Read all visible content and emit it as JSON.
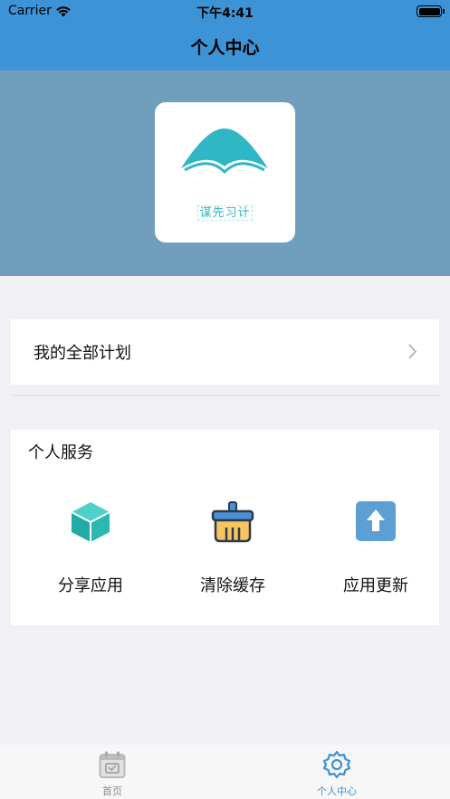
{
  "status_bar": {
    "carrier": "Carrier",
    "time": "下午4:41"
  },
  "nav": {
    "title": "个人中心"
  },
  "logo": {
    "text": "谋先习计",
    "colors": {
      "primary": "#30b7c6"
    }
  },
  "plan": {
    "label": "我的全部计划"
  },
  "services": {
    "title": "个人服务",
    "items": [
      {
        "label": "分享应用",
        "icon": "cube-icon"
      },
      {
        "label": "清除缓存",
        "icon": "broom-icon"
      },
      {
        "label": "应用更新",
        "icon": "upload-arrow-icon"
      }
    ]
  },
  "tabs": [
    {
      "label": "首页",
      "icon": "calendar-icon",
      "active": false
    },
    {
      "label": "个人中心",
      "icon": "gear-icon",
      "active": true
    }
  ],
  "colors": {
    "accent": "#3c93d6",
    "header": "#709fbe",
    "background": "#f1f1f5"
  }
}
